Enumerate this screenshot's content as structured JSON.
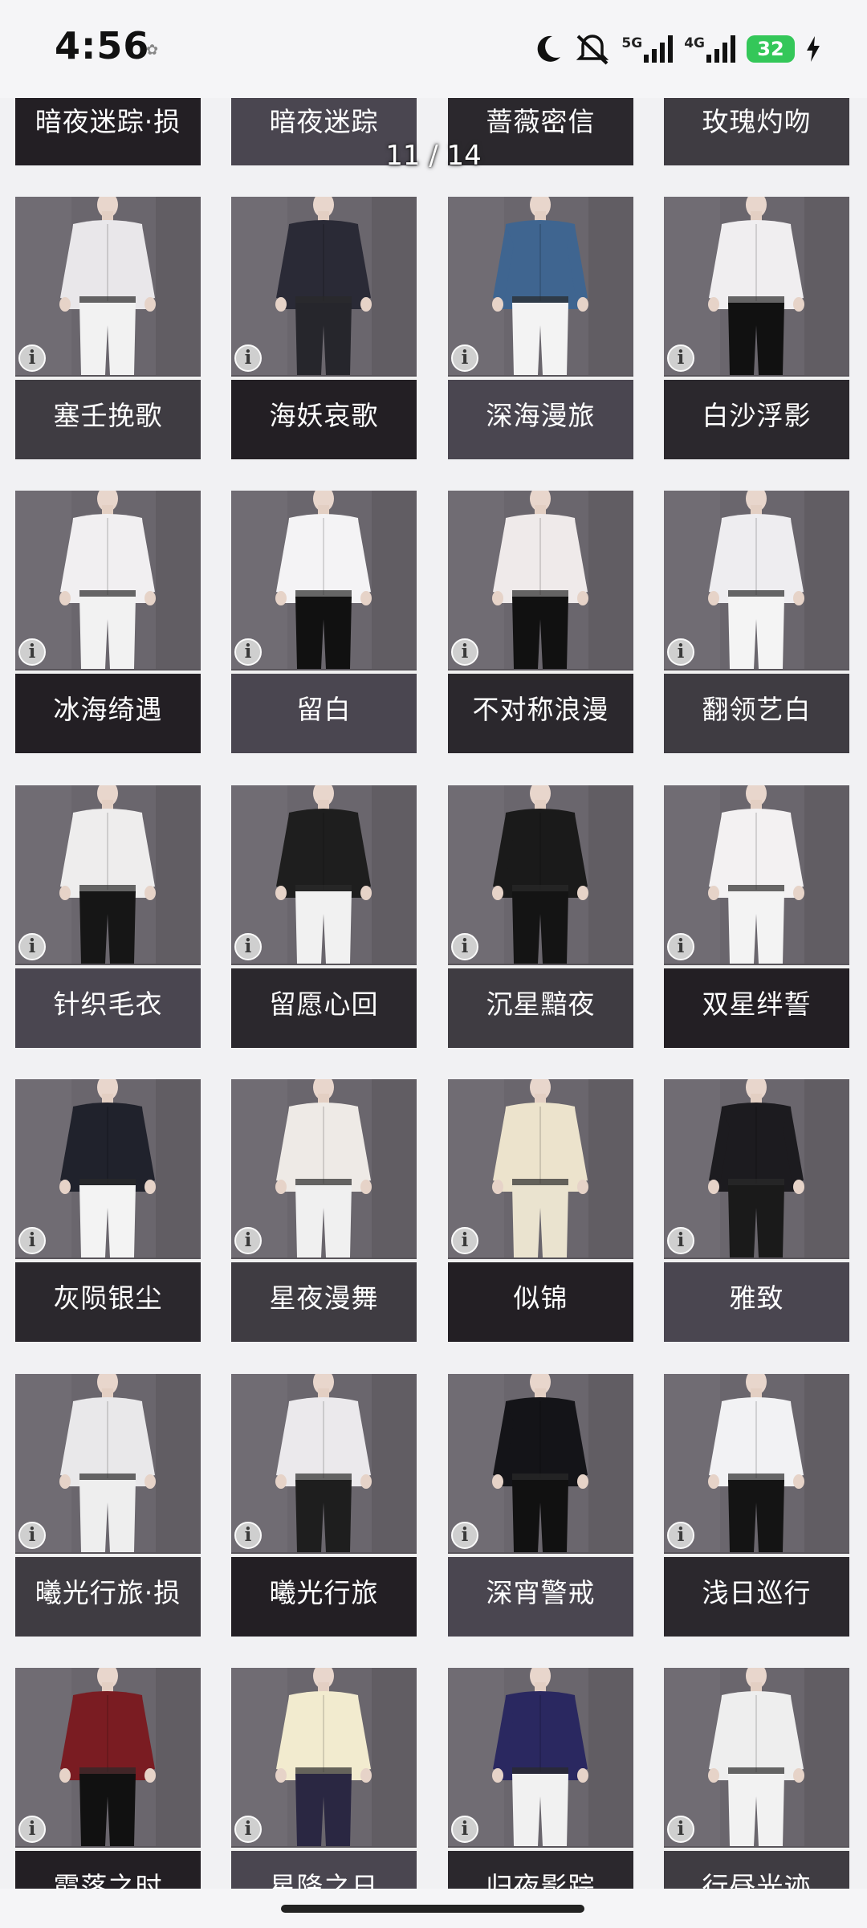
{
  "status_bar": {
    "time": "4:56",
    "network_1": "5G",
    "network_2": "4G",
    "battery": "32",
    "icons": [
      "moon-icon",
      "mute-vibrate-icon",
      "signal-5g-icon",
      "signal-4g-icon",
      "battery-icon",
      "charging-bolt-icon"
    ]
  },
  "gallery": {
    "page_indicator": "11 / 14",
    "partial_top_row": [
      "暗夜迷踪·损",
      "暗夜迷踪",
      "蔷薇密信",
      "玫瑰灼吻"
    ],
    "rows": [
      [
        "塞壬挽歌",
        "海妖哀歌",
        "深海漫旅",
        "白沙浮影"
      ],
      [
        "冰海绮遇",
        "留白",
        "不对称浪漫",
        "翻领艺白"
      ],
      [
        "针织毛衣",
        "留愿心回",
        "沉星黯夜",
        "双星绊誓"
      ],
      [
        "灰陨银尘",
        "星夜漫舞",
        "似锦",
        "雅致"
      ],
      [
        "曦光行旅·损",
        "曦光行旅",
        "深宵警戒",
        "浅日巡行"
      ],
      [
        "霞落之时",
        "星降之日",
        "归夜影踪",
        "行昼光迹"
      ]
    ],
    "info_icon_glyph": "i"
  }
}
